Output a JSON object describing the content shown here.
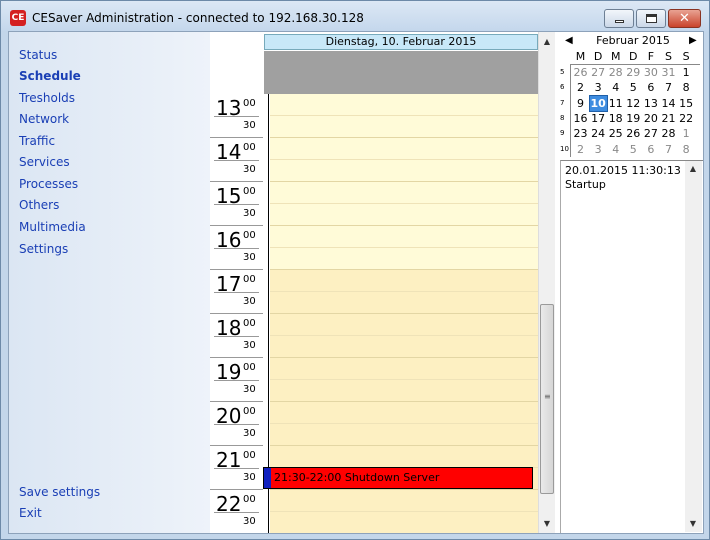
{
  "window": {
    "title": "CESaver Administration - connected to 192.168.30.128",
    "icon_label": "CE"
  },
  "sidebar": {
    "items": [
      {
        "label": "Status"
      },
      {
        "label": "Schedule",
        "active": true
      },
      {
        "label": "Tresholds"
      },
      {
        "label": "Network"
      },
      {
        "label": "Traffic"
      },
      {
        "label": "Services"
      },
      {
        "label": "Processes"
      },
      {
        "label": "Others"
      },
      {
        "label": "Multimedia"
      },
      {
        "label": "Settings"
      }
    ],
    "bottom_items": [
      {
        "label": "Save settings"
      },
      {
        "label": "Exit"
      }
    ]
  },
  "dayview": {
    "date_header": "Dienstag, 10. Februar 2015",
    "hours": [
      {
        "hour": "13",
        "m00": "00",
        "m30": "30"
      },
      {
        "hour": "14",
        "m00": "00",
        "m30": "30"
      },
      {
        "hour": "15",
        "m00": "00",
        "m30": "30"
      },
      {
        "hour": "16",
        "m00": "00",
        "m30": "30"
      },
      {
        "hour": "17",
        "m00": "00",
        "m30": "30"
      },
      {
        "hour": "18",
        "m00": "00",
        "m30": "30"
      },
      {
        "hour": "19",
        "m00": "00",
        "m30": "30"
      },
      {
        "hour": "20",
        "m00": "00",
        "m30": "30"
      },
      {
        "hour": "21",
        "m00": "00",
        "m30": "30"
      },
      {
        "hour": "22",
        "m00": "00",
        "m30": "30"
      }
    ],
    "event": {
      "text": "21:30-22:00 Shutdown Server",
      "color": "#ff0000"
    },
    "colors": {
      "work_hours": "#fffbd8",
      "after_hours": "#fdf0c2"
    }
  },
  "minical": {
    "title": "Februar 2015",
    "prev_glyph": "◀",
    "next_glyph": "▶",
    "dows": [
      "M",
      "D",
      "M",
      "D",
      "F",
      "S",
      "S"
    ],
    "weeks": [
      {
        "wk": "5",
        "days": [
          {
            "d": "26",
            "o": true
          },
          {
            "d": "27",
            "o": true
          },
          {
            "d": "28",
            "o": true
          },
          {
            "d": "29",
            "o": true
          },
          {
            "d": "30",
            "o": true
          },
          {
            "d": "31",
            "o": true
          },
          {
            "d": "1"
          }
        ]
      },
      {
        "wk": "6",
        "days": [
          {
            "d": "2"
          },
          {
            "d": "3"
          },
          {
            "d": "4"
          },
          {
            "d": "5"
          },
          {
            "d": "6"
          },
          {
            "d": "7"
          },
          {
            "d": "8"
          }
        ]
      },
      {
        "wk": "7",
        "days": [
          {
            "d": "9"
          },
          {
            "d": "10",
            "today": true
          },
          {
            "d": "11"
          },
          {
            "d": "12"
          },
          {
            "d": "13"
          },
          {
            "d": "14"
          },
          {
            "d": "15"
          }
        ]
      },
      {
        "wk": "8",
        "days": [
          {
            "d": "16"
          },
          {
            "d": "17"
          },
          {
            "d": "18"
          },
          {
            "d": "19"
          },
          {
            "d": "20"
          },
          {
            "d": "21"
          },
          {
            "d": "22"
          }
        ]
      },
      {
        "wk": "9",
        "days": [
          {
            "d": "23"
          },
          {
            "d": "24"
          },
          {
            "d": "25"
          },
          {
            "d": "26"
          },
          {
            "d": "27"
          },
          {
            "d": "28"
          },
          {
            "d": "1",
            "o": true
          }
        ]
      },
      {
        "wk": "10",
        "days": [
          {
            "d": "2",
            "o": true
          },
          {
            "d": "3",
            "o": true
          },
          {
            "d": "4",
            "o": true
          },
          {
            "d": "5",
            "o": true
          },
          {
            "d": "6",
            "o": true
          },
          {
            "d": "7",
            "o": true
          },
          {
            "d": "8",
            "o": true
          }
        ]
      }
    ]
  },
  "log": {
    "lines": [
      "20.01.2015 11:30:13",
      "  Startup"
    ]
  }
}
